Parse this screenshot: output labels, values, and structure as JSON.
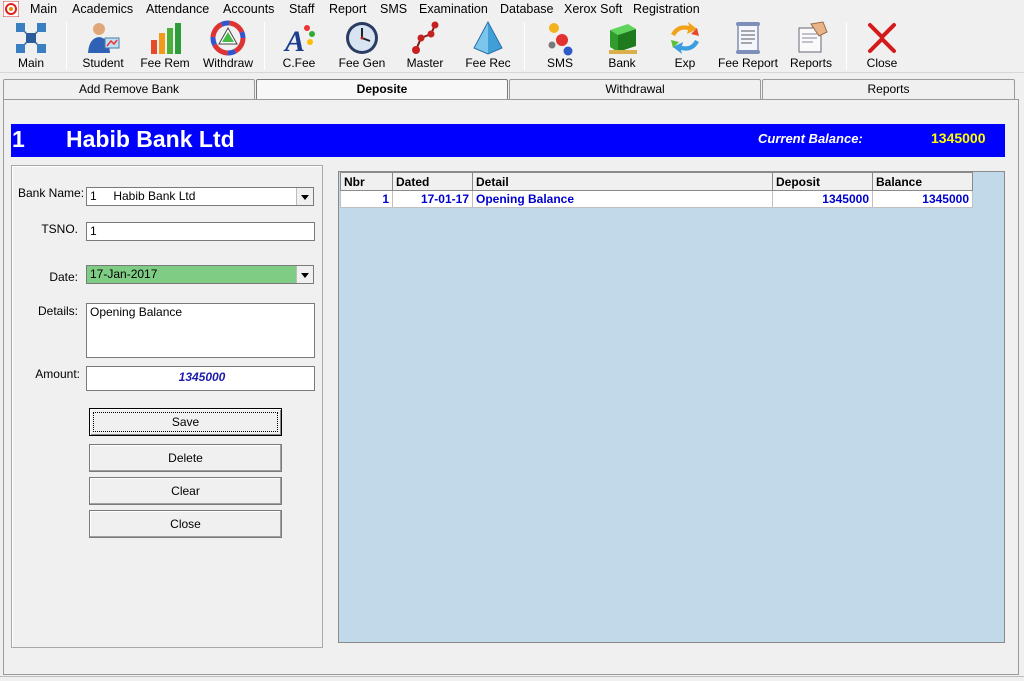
{
  "menu": [
    "Main",
    "Academics",
    "Attendance",
    "Accounts",
    "Staff",
    "Report",
    "SMS",
    "Examination",
    "Database",
    "Xerox Soft",
    "Registration"
  ],
  "toolbar": [
    {
      "label": "Main",
      "icon": "main-grid-icon"
    },
    {
      "label": "Student",
      "icon": "student-icon"
    },
    {
      "label": "Fee Rem",
      "icon": "bar-chart-icon"
    },
    {
      "label": "Withdraw",
      "icon": "color-wheel-icon"
    },
    {
      "label": "C.Fee",
      "icon": "font-icon"
    },
    {
      "label": "Fee Gen",
      "icon": "clock-icon"
    },
    {
      "label": "Master",
      "icon": "molecule-icon"
    },
    {
      "label": "Fee Rec",
      "icon": "pyramid-icon"
    },
    {
      "label": "SMS",
      "icon": "balls-icon"
    },
    {
      "label": "Bank",
      "icon": "bank-box-icon"
    },
    {
      "label": "Exp",
      "icon": "arrows-icon"
    },
    {
      "label": "Fee Report",
      "icon": "scroll-icon"
    },
    {
      "label": "Reports",
      "icon": "report-hand-icon"
    },
    {
      "label": "Close",
      "icon": "close-icon"
    }
  ],
  "tabs": [
    {
      "label": "Add Remove Bank",
      "active": false
    },
    {
      "label": "Deposite",
      "active": true
    },
    {
      "label": "Withdrawal",
      "active": false
    },
    {
      "label": "Reports",
      "active": false
    }
  ],
  "header": {
    "bank_nbr": "1",
    "bank_name": "Habib Bank Ltd",
    "balance_label": "Current Balance:",
    "balance_value": "1345000",
    "bar_color": "#0000ff",
    "balance_color": "#ffff00"
  },
  "form": {
    "bank_name_label": "Bank Name:",
    "bank_name_value": "1     Habib Bank Ltd",
    "tsno_label": "TSNO.",
    "tsno_value": "1",
    "date_label": "Date:",
    "date_value": "17-Jan-2017",
    "date_color": "#7fcc85",
    "details_label": "Details:",
    "details_value": "Opening Balance",
    "amount_label": "Amount:",
    "amount_value": "1345000"
  },
  "buttons": {
    "save": "Save",
    "delete": "Delete",
    "clear": "Clear",
    "close": "Close"
  },
  "grid": {
    "columns": [
      "Nbr",
      "Dated",
      "Detail",
      "Deposit",
      "Balance"
    ],
    "rows": [
      {
        "nbr": "1",
        "dated": "17-01-17",
        "detail": "Opening Balance",
        "deposit": "1345000",
        "balance": "1345000"
      }
    ],
    "area_color": "#c1d9e8",
    "text_color": "#0000cd"
  }
}
